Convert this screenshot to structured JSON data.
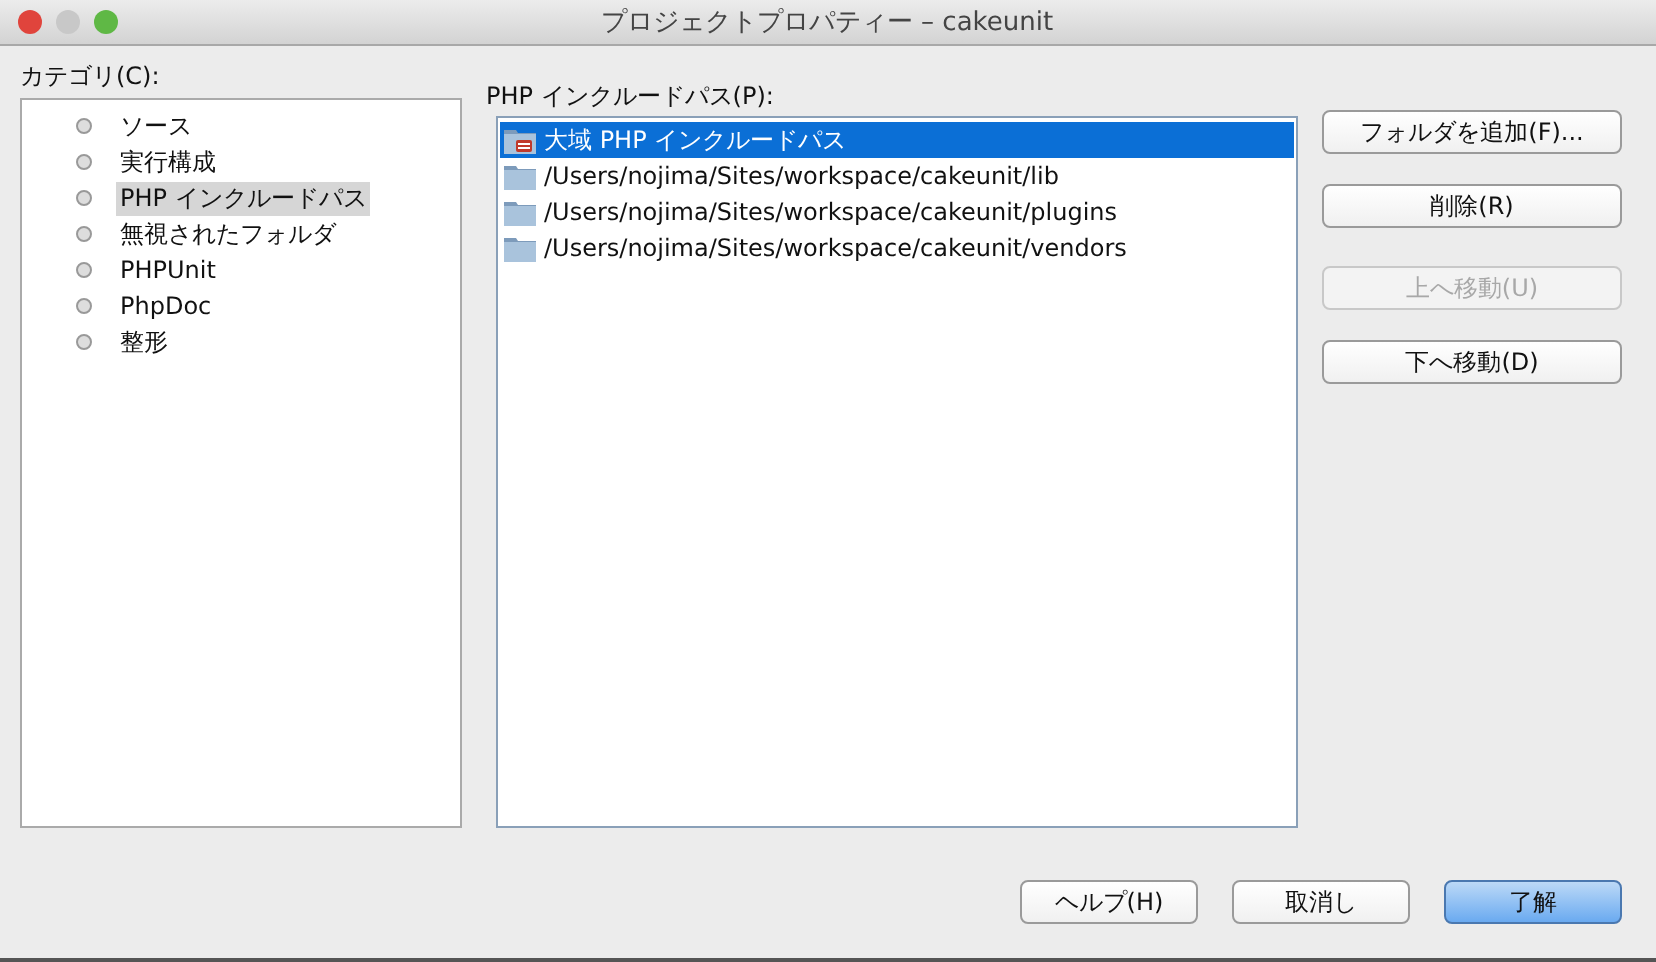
{
  "window": {
    "title": "プロジェクトプロパティー – cakeunit"
  },
  "categories_label": "カテゴリ(C):",
  "categories": [
    {
      "label": "ソース",
      "selected": false
    },
    {
      "label": "実行構成",
      "selected": false
    },
    {
      "label": "PHP インクルードパス",
      "selected": true
    },
    {
      "label": "無視されたフォルダ",
      "selected": false
    },
    {
      "label": "PHPUnit",
      "selected": false
    },
    {
      "label": "PhpDoc",
      "selected": false
    },
    {
      "label": "整形",
      "selected": false
    }
  ],
  "include_path_label": "PHP インクルードパス(P):",
  "include_paths": [
    {
      "label": "大域 PHP インクルードパス",
      "kind": "global",
      "selected": true
    },
    {
      "label": "/Users/nojima/Sites/workspace/cakeunit/lib",
      "kind": "folder",
      "selected": false
    },
    {
      "label": "/Users/nojima/Sites/workspace/cakeunit/plugins",
      "kind": "folder",
      "selected": false
    },
    {
      "label": "/Users/nojima/Sites/workspace/cakeunit/vendors",
      "kind": "folder",
      "selected": false
    }
  ],
  "side_buttons": [
    {
      "label": "フォルダを追加(F)...",
      "disabled": false
    },
    {
      "label": "削除(R)",
      "disabled": false
    },
    {
      "label": "上へ移動(U)",
      "disabled": true
    },
    {
      "label": "下へ移動(D)",
      "disabled": false
    }
  ],
  "footer_buttons": [
    {
      "label": "ヘルプ(H)",
      "default": false
    },
    {
      "label": "取消し",
      "default": false
    },
    {
      "label": "了解",
      "default": true
    }
  ]
}
